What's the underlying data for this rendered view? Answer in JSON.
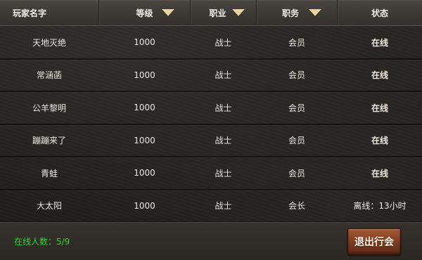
{
  "header": {
    "name": "玩家名字",
    "level": "等级",
    "class": "职业",
    "role": "职务",
    "status": "状态"
  },
  "rows": [
    {
      "name": "天地灭绝",
      "level": "1000",
      "class": "战士",
      "role": "会员",
      "status": "在线",
      "role_type": "member",
      "status_type": "online"
    },
    {
      "name": "常涵菡",
      "level": "1000",
      "class": "战士",
      "role": "会员",
      "status": "在线",
      "role_type": "member",
      "status_type": "online"
    },
    {
      "name": "公羊黎明",
      "level": "1000",
      "class": "战士",
      "role": "会员",
      "status": "在线",
      "role_type": "member",
      "status_type": "online"
    },
    {
      "name": "蹦蹦来了",
      "level": "1000",
      "class": "战士",
      "role": "会员",
      "status": "在线",
      "role_type": "member",
      "status_type": "online"
    },
    {
      "name": "青蛙",
      "level": "1000",
      "class": "战士",
      "role": "会员",
      "status": "在线",
      "role_type": "member",
      "status_type": "online"
    },
    {
      "name": "大太阳",
      "level": "1000",
      "class": "战士",
      "role": "会长",
      "status": "离线：13小时",
      "role_type": "leader",
      "status_type": "offline"
    }
  ],
  "footer": {
    "online_count": "在线人数：5/9",
    "quit_label": "退出行会"
  },
  "colors": {
    "online": "#33d62f",
    "leader": "#ffe63a",
    "text": "#ece7de"
  }
}
